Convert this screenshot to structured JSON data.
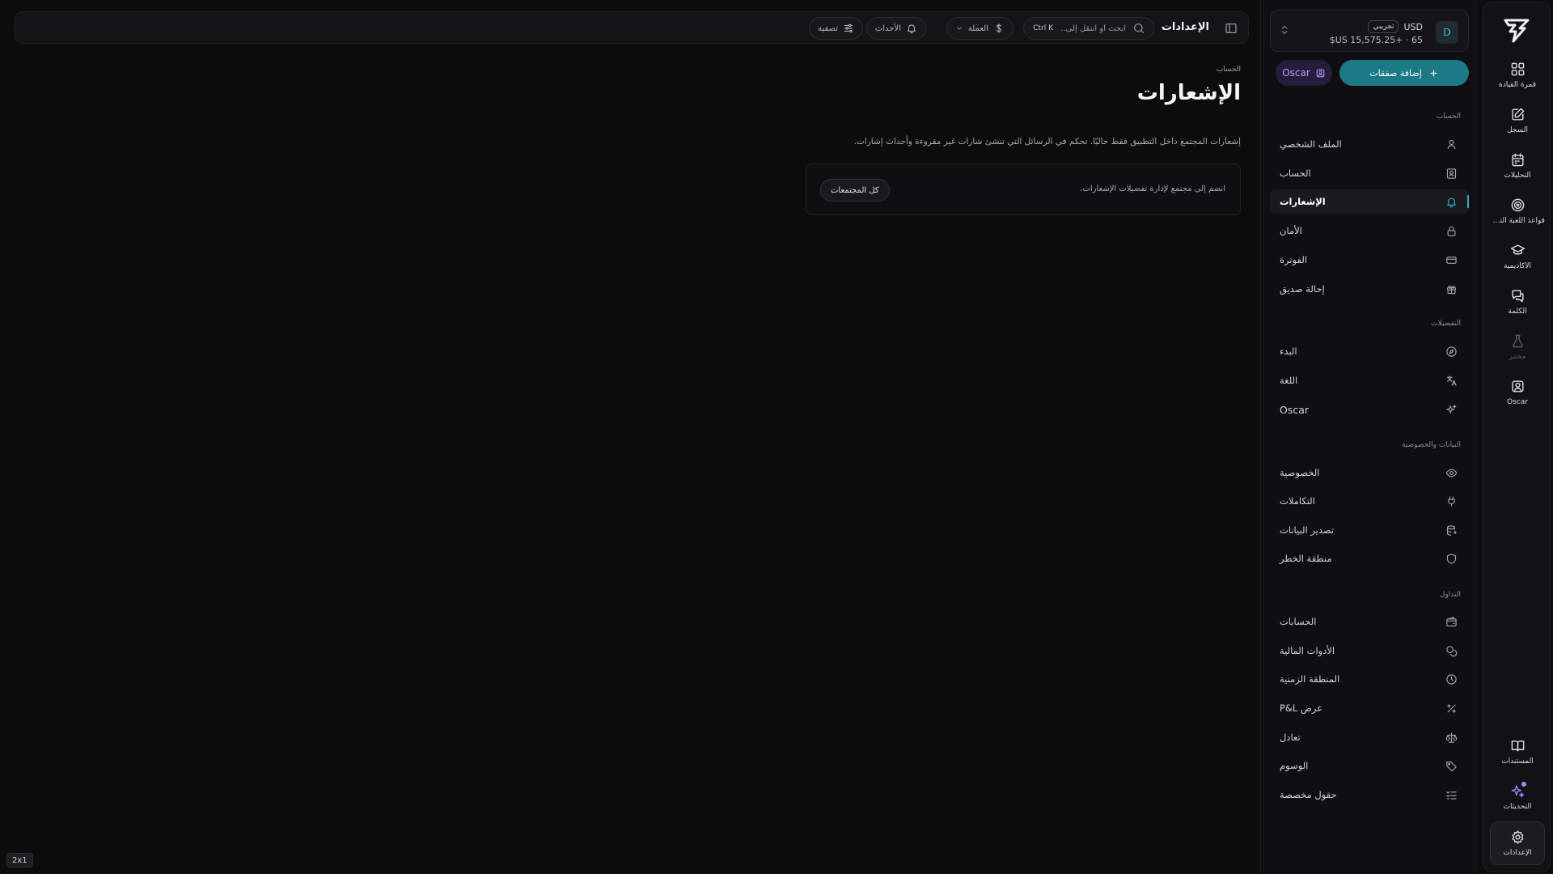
{
  "rail": {
    "items": [
      {
        "label": "قمرة القيادة",
        "icon": "grid-icon"
      },
      {
        "label": "السجل",
        "icon": "edit-icon"
      },
      {
        "label": "التحليلات",
        "icon": "calendar-icon"
      },
      {
        "label": "قواعد اللعبة التي تما...",
        "icon": "target-icon"
      },
      {
        "label": "الأكاديمية",
        "icon": "graduation-cap-icon"
      },
      {
        "label": "الكلمة",
        "icon": "chat-icon"
      },
      {
        "label": "مختبر",
        "icon": "flask-icon"
      },
      {
        "label": "Oscar",
        "icon": "oscar-icon"
      }
    ],
    "bottom": [
      {
        "label": "المستندات",
        "icon": "book-icon"
      },
      {
        "label": "التحديثات",
        "icon": "sparkles-icon"
      },
      {
        "label": "الإعدادات",
        "icon": "gear-icon"
      }
    ]
  },
  "account": {
    "avatar": "D",
    "currency": "USD",
    "badge": "تجريبي",
    "balance": "$US 15,575.25+ · 65"
  },
  "sidebar": {
    "add_trades": "إضافة صفقات",
    "oscar": "Oscar",
    "sections": {
      "account": "الحساب",
      "preferences": "التفضيلات",
      "data_privacy": "البيانات والخصوصية",
      "trading": "التداول"
    },
    "account_items": [
      "الملف الشخصي",
      "الحساب",
      "الإشعارات",
      "الأمان",
      "الفوترة",
      "إحالة صديق"
    ],
    "preference_items": [
      "البدء",
      "اللغة",
      "Oscar"
    ],
    "data_items": [
      "الخصوصية",
      "التكاملات",
      "تصدير البيانات",
      "منطقة الخطر"
    ],
    "trading_items": [
      "الحسابات",
      "الأدوات المالية",
      "المنطقة الزمنية",
      "عرض P&L",
      "تعادل",
      "الوسوم",
      "حقول مخصصة"
    ]
  },
  "topbar": {
    "title": "الإعدادات",
    "search_placeholder": "ابحث أو انتقل إلى...",
    "shortcut": "Ctrl K",
    "currency": "العملة",
    "events": "الأحداث",
    "filter": "تصفية"
  },
  "main": {
    "breadcrumb": "الحساب",
    "title": "الإشعارات",
    "description": "إشعارات المجتمع داخل التطبيق فقط حاليًا. تحكم في الرسائل التي تنشئ شارات غير مقروءة وأحداث إشارات.",
    "notice": "انضم إلى مجتمع لإدارة تفضيلات الإشعارات.",
    "all_communities": "كل المجتمعات"
  },
  "corner_badge": "2x1",
  "colors": {
    "accent": "#2bb3c0",
    "primary_button": "#1b7a86",
    "oscar": "#b79bff",
    "background": "#0c0c0d"
  }
}
